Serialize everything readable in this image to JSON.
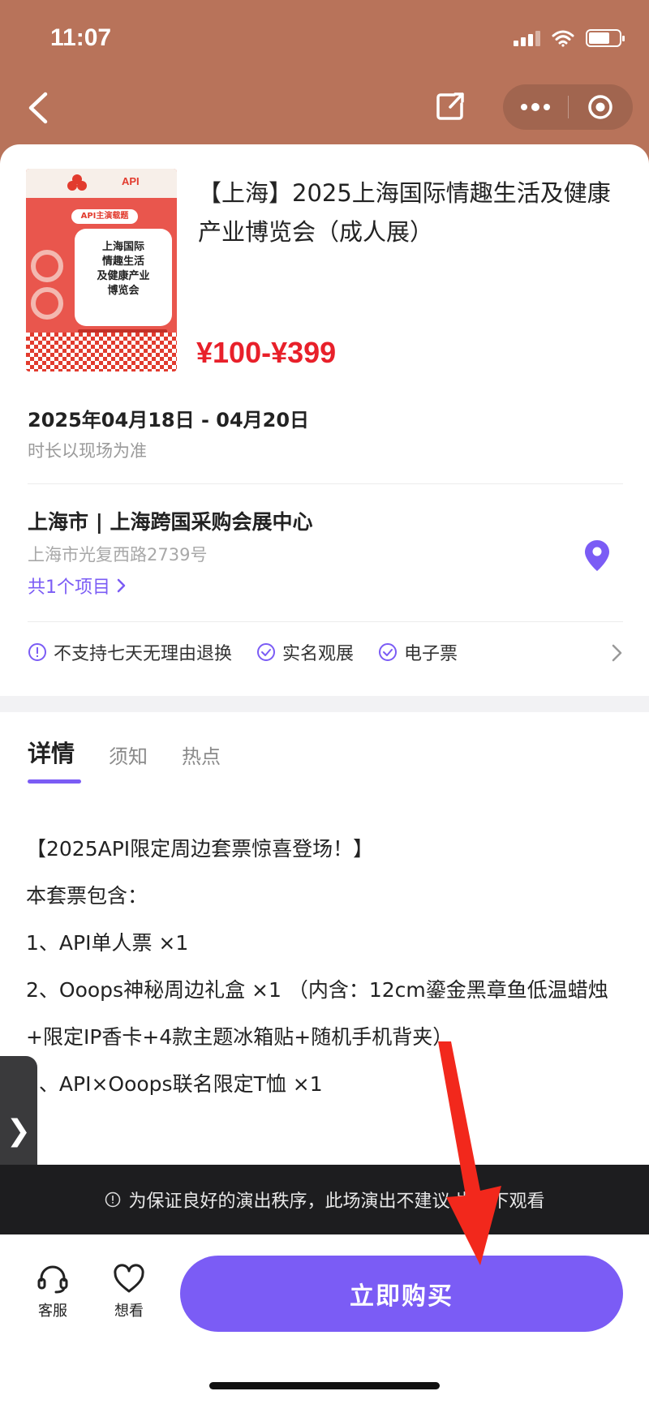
{
  "status_bar": {
    "time": "11:07"
  },
  "event": {
    "title": "【上海】2025上海国际情趣生活及健康产业博览会（成人展）",
    "price": "¥100-¥399",
    "date_range": "2025年04月18日 - 04月20日",
    "duration_note": "时长以现场为准",
    "venue": "上海市 | 上海跨国采购会展中心",
    "address": "上海市光复西路2739号",
    "projects_link": "共1个项目",
    "poster": {
      "brand": "API",
      "pill": "API主演载题",
      "lines": [
        "上海国际",
        "情趣生活",
        "及健康产业",
        "博览会"
      ]
    }
  },
  "policies": [
    {
      "label": "不支持七天无理由退换",
      "icon": "info-icon"
    },
    {
      "label": "实名观展",
      "icon": "check-circle-icon"
    },
    {
      "label": "电子票",
      "icon": "check-circle-icon"
    }
  ],
  "tabs": [
    "详情",
    "须知",
    "热点"
  ],
  "description": [
    "【2025API限定周边套票惊喜登场！】",
    "本套票包含：",
    "1、API单人票 ×1",
    "2、Ooops神秘周边礼盒 ×1 （内含：12cm鎏金黑章鱼低温蜡烛+限定IP香卡+4款主题冰箱贴+随机手机背夹）",
    "3、API×Ooops联名限定T恤 ×1"
  ],
  "notice": "为保证良好的演出秩序，此场演出不建议  岁以下观看",
  "side_tab": "❯",
  "bottom": {
    "customer_service": "客服",
    "want_to_see": "想看",
    "buy": "立即购买"
  },
  "colors": {
    "header": "#b8735a",
    "accent": "#7b5cf5",
    "price": "#e8202a",
    "annotation_arrow": "#f2281c"
  }
}
